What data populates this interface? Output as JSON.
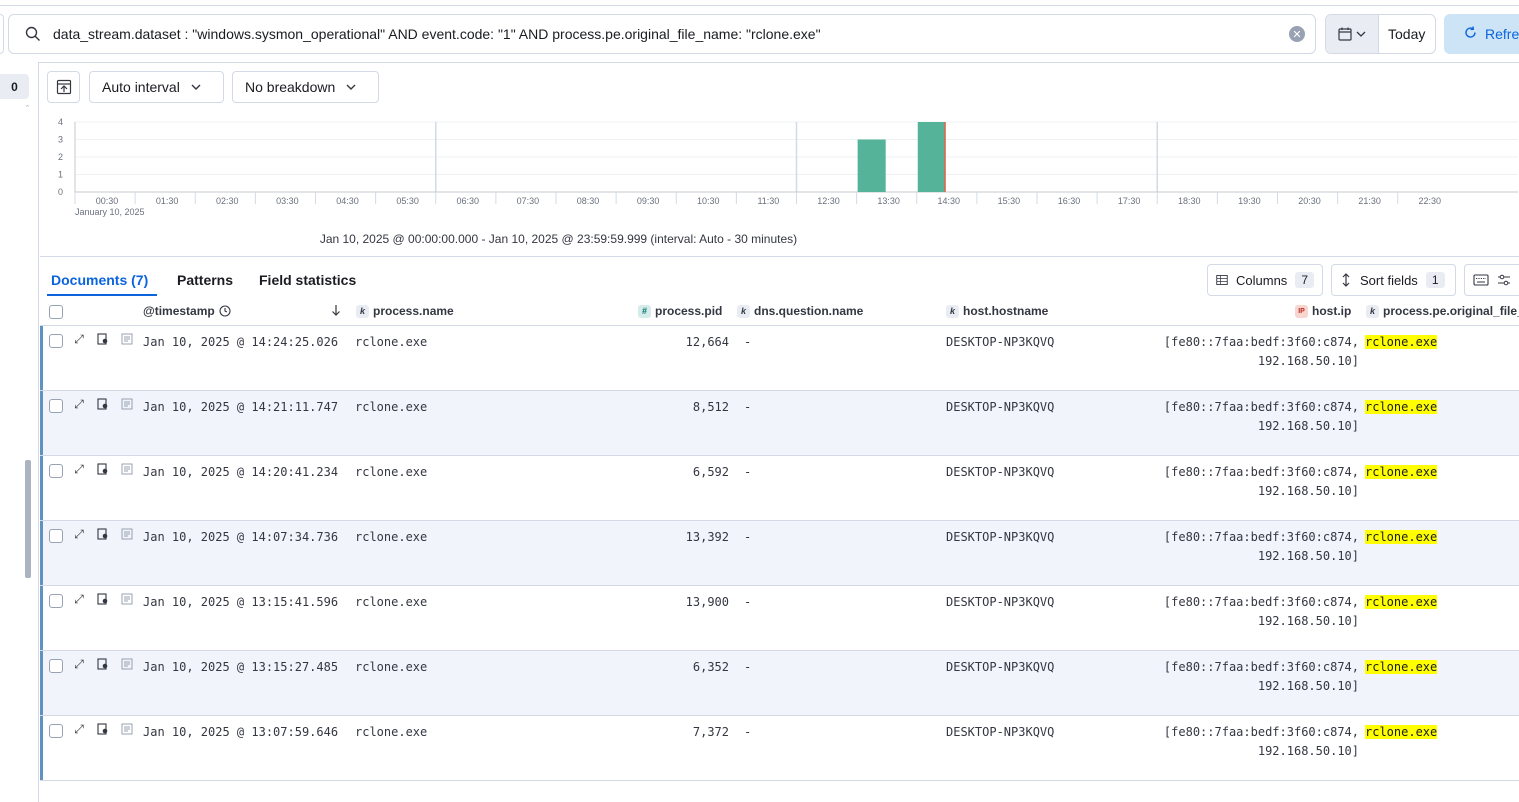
{
  "query": {
    "text": "data_stream.dataset : \"windows.sysmon_operational\" AND event.code: \"1\" AND process.pe.original_file_name: \"rclone.exe\""
  },
  "date_picker": {
    "label": "Today"
  },
  "refresh": {
    "label": "Refresh"
  },
  "sidebar": {
    "count_badge": "0"
  },
  "chart_toolbar": {
    "interval_label": "Auto interval",
    "breakdown_label": "No breakdown"
  },
  "chart_data": {
    "type": "bar",
    "title": "",
    "xlabel": "",
    "ylabel": "",
    "x_tick_labels": [
      "00:30",
      "01:30",
      "02:30",
      "03:30",
      "04:30",
      "05:30",
      "06:30",
      "07:30",
      "08:30",
      "09:30",
      "10:30",
      "11:30",
      "12:30",
      "13:30",
      "14:30",
      "15:30",
      "16:30",
      "17:30",
      "18:30",
      "19:30",
      "20:30",
      "21:30",
      "22:30"
    ],
    "x_date_label": "January 10, 2025",
    "y_ticks": [
      0,
      1,
      2,
      3,
      4
    ],
    "ylim": [
      0,
      4
    ],
    "bars": [
      {
        "bucket": "13:00",
        "value": 3
      },
      {
        "bucket": "14:00",
        "value": 4
      }
    ],
    "now_marker": "14:30",
    "bar_color": "#54b399",
    "grid": true,
    "caption": "Jan 10, 2025 @ 00:00:00.000 - Jan 10, 2025 @ 23:59:59.999 (interval: Auto - 30 minutes)"
  },
  "tabs": [
    {
      "label": "Documents (7)",
      "active": true
    },
    {
      "label": "Patterns",
      "active": false
    },
    {
      "label": "Field statistics",
      "active": false
    }
  ],
  "grid_controls": {
    "columns_label": "Columns",
    "columns_count": "7",
    "sort_label": "Sort fields",
    "sort_count": "1"
  },
  "columns": {
    "timestamp": "@timestamp",
    "process_name": "process.name",
    "process_pid": "process.pid",
    "dns_question_name": "dns.question.name",
    "host_hostname": "host.hostname",
    "host_ip": "host.ip",
    "original_file_name": "process.pe.original_file_name"
  },
  "type_badges": {
    "keyword": "k",
    "number": "#",
    "ip": "IP"
  },
  "rows": [
    {
      "timestamp": "Jan 10, 2025 @ 14:24:25.026",
      "process_name": "rclone.exe",
      "pid": "12,664",
      "dns": "-",
      "hostname": "DESKTOP-NP3KQVQ",
      "ip_line1": "[fe80::7faa:bedf:3f60:c874,",
      "ip_line2": "192.168.50.10]",
      "original_file_name": "rclone.exe"
    },
    {
      "timestamp": "Jan 10, 2025 @ 14:21:11.747",
      "process_name": "rclone.exe",
      "pid": "8,512",
      "dns": "-",
      "hostname": "DESKTOP-NP3KQVQ",
      "ip_line1": "[fe80::7faa:bedf:3f60:c874,",
      "ip_line2": "192.168.50.10]",
      "original_file_name": "rclone.exe"
    },
    {
      "timestamp": "Jan 10, 2025 @ 14:20:41.234",
      "process_name": "rclone.exe",
      "pid": "6,592",
      "dns": "-",
      "hostname": "DESKTOP-NP3KQVQ",
      "ip_line1": "[fe80::7faa:bedf:3f60:c874,",
      "ip_line2": "192.168.50.10]",
      "original_file_name": "rclone.exe"
    },
    {
      "timestamp": "Jan 10, 2025 @ 14:07:34.736",
      "process_name": "rclone.exe",
      "pid": "13,392",
      "dns": "-",
      "hostname": "DESKTOP-NP3KQVQ",
      "ip_line1": "[fe80::7faa:bedf:3f60:c874,",
      "ip_line2": "192.168.50.10]",
      "original_file_name": "rclone.exe"
    },
    {
      "timestamp": "Jan 10, 2025 @ 13:15:41.596",
      "process_name": "rclone.exe",
      "pid": "13,900",
      "dns": "-",
      "hostname": "DESKTOP-NP3KQVQ",
      "ip_line1": "[fe80::7faa:bedf:3f60:c874,",
      "ip_line2": "192.168.50.10]",
      "original_file_name": "rclone.exe"
    },
    {
      "timestamp": "Jan 10, 2025 @ 13:15:27.485",
      "process_name": "rclone.exe",
      "pid": "6,352",
      "dns": "-",
      "hostname": "DESKTOP-NP3KQVQ",
      "ip_line1": "[fe80::7faa:bedf:3f60:c874,",
      "ip_line2": "192.168.50.10]",
      "original_file_name": "rclone.exe"
    },
    {
      "timestamp": "Jan 10, 2025 @ 13:07:59.646",
      "process_name": "rclone.exe",
      "pid": "7,372",
      "dns": "-",
      "hostname": "DESKTOP-NP3KQVQ",
      "ip_line1": "[fe80::7faa:bedf:3f60:c874,",
      "ip_line2": "192.168.50.10]",
      "original_file_name": "rclone.exe"
    }
  ]
}
